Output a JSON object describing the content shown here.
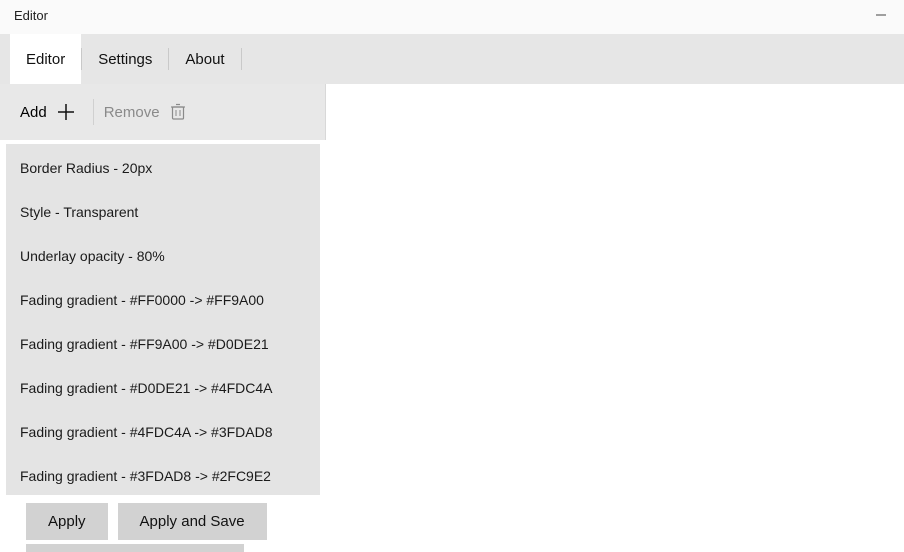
{
  "window": {
    "title": "Editor"
  },
  "tabs": [
    {
      "label": "Editor",
      "active": true
    },
    {
      "label": "Settings",
      "active": false
    },
    {
      "label": "About",
      "active": false
    }
  ],
  "toolbar": {
    "add_label": "Add",
    "remove_label": "Remove"
  },
  "items": [
    "Border Radius - 20px",
    "Style - Transparent",
    "Underlay opacity - 80%",
    "Fading gradient - #FF0000 -> #FF9A00",
    "Fading gradient - #FF9A00 -> #D0DE21",
    "Fading gradient - #D0DE21 -> #4FDC4A",
    "Fading gradient - #4FDC4A -> #3FDAD8",
    "Fading gradient - #3FDAD8 -> #2FC9E2"
  ],
  "actions": {
    "apply_label": "Apply",
    "apply_save_label": "Apply and Save"
  }
}
